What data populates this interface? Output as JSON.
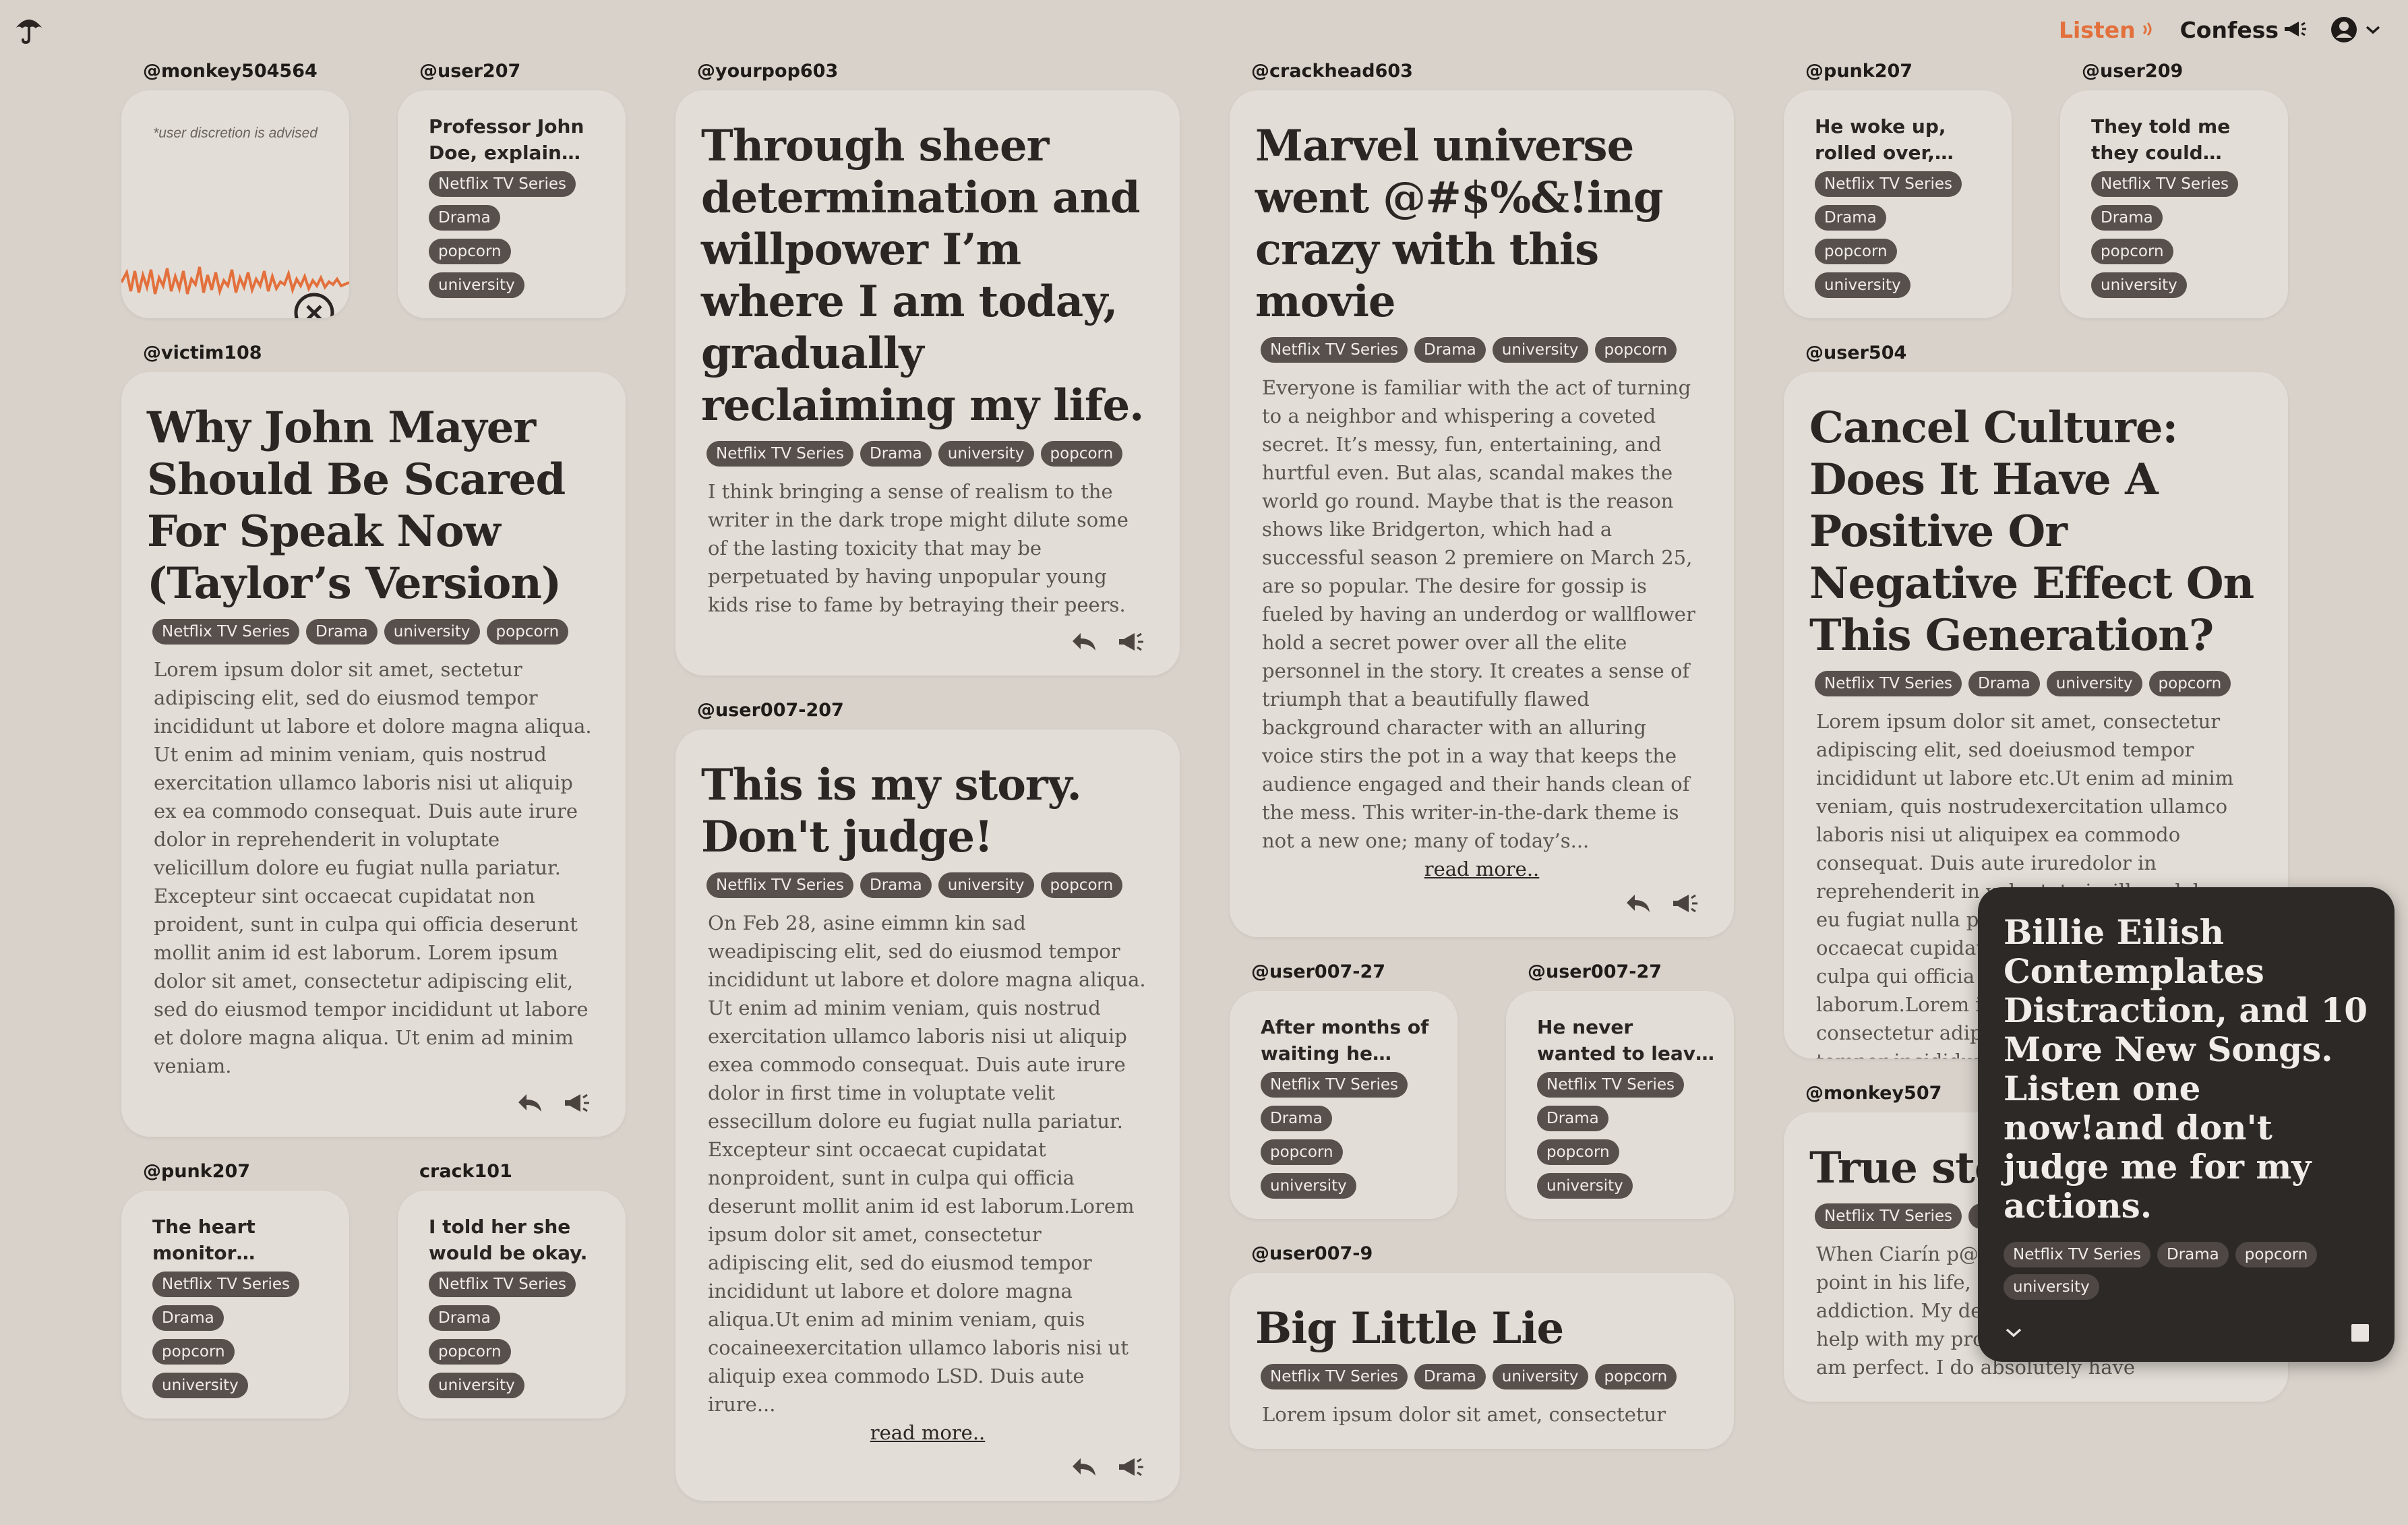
{
  "nav": {
    "listen": "Listen",
    "confess": "Confess"
  },
  "colors": {
    "accent": "#e3703c",
    "background": "#d8d2ca",
    "card": "#e2ddd6",
    "tag": "#58504c"
  },
  "icons": {
    "logo": "umbrella-icon",
    "listen": "sound-waves-icon",
    "confess": "megaphone-icon",
    "account": "account-circle-icon",
    "reply": "reply-icon",
    "amplify": "megaphone-icon",
    "close": "close-circle-icon",
    "collapse": "chevron-down-icon",
    "stop": "stop-icon"
  },
  "tags": {
    "netflix": "Netflix TV Series",
    "drama": "Drama",
    "university": "university",
    "popcorn": "popcorn"
  },
  "read_more": "read more..",
  "cards": {
    "monkey504564": {
      "handle": "@monkey504564",
      "advisory": "*user discretion is advised"
    },
    "user207": {
      "handle": "@user207",
      "teaser": "Professor John Doe, explain the..."
    },
    "victim108": {
      "handle": "@victim108",
      "title": "Why John Mayer Should Be Scared For Speak Now (Taylor’s Version)",
      "body": "Lorem ipsum dolor sit amet, sectetur adipiscing elit, sed do eiusmod tempor incididunt ut labore et dolore magna aliqua. Ut enim ad minim veniam, quis nostrud exercitation ullamco laboris nisi ut aliquip ex ea commodo consequat. Duis aute irure dolor in reprehenderit in voluptate velicillum dolore eu fugiat nulla pariatur. Excepteur sint occaecat cupidatat non proident, sunt in culpa qui officia deserunt mollit anim id est laborum. Lorem ipsum dolor sit amet, consectetur adipiscing elit, sed do eiusmod tempor incididunt ut labore et dolore magna aliqua. Ut enim ad minim veniam."
    },
    "punk207_small": {
      "handle": "@punk207",
      "teaser": "The heart monitor chimed..."
    },
    "crack101": {
      "handle": "crack101",
      "teaser": "I told her she would be okay."
    },
    "yourpop603": {
      "handle": "@yourpop603",
      "title": "Through sheer determination and willpower I’m where I am today, gradually reclaiming my life.",
      "body": "I think bringing a sense of realism to the writer in the dark trope might dilute some of the lasting toxicity that may be perpetuated by having unpopular young kids rise to fame by betraying their peers."
    },
    "user007_207": {
      "handle": "@user007-207",
      "title": "This is my story. Don't judge!",
      "body": "On Feb 28, asine eimmn kin sad weadipiscing elit, sed do eiusmod tempor incididunt ut labore et dolore magna aliqua. Ut enim ad minim veniam, quis nostrud exercitation ullamco laboris nisi ut aliquip exea commodo consequat. Duis aute irure dolor in first time in voluptate velit essecillum dolore eu fugiat nulla pariatur. Excepteur sint occaecat cupidatat nonproident, sunt in culpa qui officia deserunt mollit anim id est laborum.Lorem ipsum dolor sit amet, consectetur adipiscing elit, sed do eiusmod tempor incididunt ut labore et dolore magna aliqua.Ut enim ad minim veniam, quis cocaineexercitation ullamco laboris nisi ut aliquip exea commodo LSD. Duis aute irure..."
    },
    "crackhead603": {
      "handle": "@crackhead603",
      "title": "Marvel universe went @#$%&!ing crazy with this movie",
      "body": "Everyone is familiar with the act of turning to a neighbor and whispering a coveted secret. It’s messy, fun, entertaining, and hurtful even. But alas, scandal makes the world go round. Maybe that is the reason shows like Bridgerton, which had a successful season 2 premiere on March 25, are so popular. The desire for gossip is fueled by having an underdog or wallflower hold a secret power over all the elite personnel in the story. It creates a sense of triumph that a beautifully flawed background character with an alluring voice stirs the pot in a way that keeps the audience engaged and their hands clean of the mess. This writer-in-the-dark theme is not a new one; many of today’s..."
    },
    "user007_27a": {
      "handle": "@user007-27",
      "teaser": "After months of waiting he finall..."
    },
    "user007_27b": {
      "handle": "@user007-27",
      "teaser": "He never wanted to leave his wife."
    },
    "user007_9": {
      "handle": "@user007-9",
      "title": "Big Little Lie",
      "body": "Lorem ipsum dolor sit amet, consectetur"
    },
    "punk207": {
      "handle": "@punk207",
      "teaser": "He woke up, rolled over, and..."
    },
    "user209": {
      "handle": "@user209",
      "teaser": "They told me they could save..."
    },
    "user504": {
      "handle": "@user504",
      "title": "Cancel Culture: Does It Have A Positive Or Negative Effect On This Generation?",
      "body": "Lorem ipsum dolor sit amet, consectetur adipiscing elit, sed doeiusmod tempor incididunt ut labore etc.Ut enim ad minim veniam, quis nostrudexercitation ullamco laboris nisi ut aliquipex ea commodo consequat. Duis aute iruredolor in reprehenderit in voluptate iscillum dolore eu fugiat nulla pariatur.Excepteur sint occaecat cupidatat nonproident, sunt in culpa qui officia deseruntmollit anim id est laborum.Lorem ipsum dolor sit amet, consectetur adipiscing elit, sed do eiusmod tempor incididunt ut labore et dolore magna aliqua."
    },
    "monkey507": {
      "handle": "@monkey507",
      "title": "True story",
      "body": "When Ciarín p@#$%! was at a deciding point in his life, he had to face his addiction. My dear, things got better, I got help with my problems. I'd like to say that I am perfect. I do absolutely have"
    }
  },
  "player": {
    "title": "Billie Eilish Contemplates Distraction, and 10 More New Songs. Listen one now!and don't judge me for my actions."
  }
}
